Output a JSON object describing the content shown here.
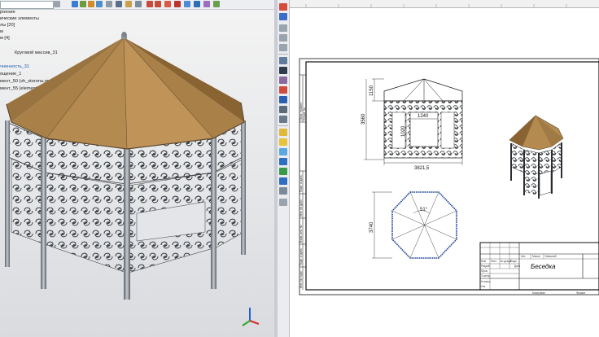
{
  "tree": {
    "items": [
      "роения",
      "ические элементы",
      "лы [20]",
      "м",
      "м [4]",
      "Круговой массив_31",
      "чненность_31",
      "ощение_1",
      "мент_50 (vh_storona.grs)",
      "мент_55 (element1verh.grs)"
    ]
  },
  "drawing": {
    "dimensions": {
      "roof_height": "1150",
      "total_height": "3560",
      "door_height": "1020",
      "door_width": "1240",
      "overall_width": "3821,5",
      "plan_width": "3740",
      "angle": "51°"
    },
    "title_block": {
      "part_name": "Беседка",
      "cells": [
        "Изм",
        "Лист",
        "№ докум.",
        "Подп.",
        "Дата",
        "Разраб.",
        "Пров.",
        "Т.контр.",
        "Н.контр.",
        "Утв.",
        "Лит.",
        "Масса",
        "Масштаб",
        "Копировал",
        "Формат"
      ]
    },
    "side_stamp": [
      "Перв. примен.",
      "Справ. №",
      "Подп. и дата",
      "Инв. № дубл.",
      "Взам. инв. №",
      "Подп. и дата",
      "Инв. № подл."
    ]
  },
  "colors": {
    "roof": "#b58a50",
    "roof_shade": "#8a6332",
    "metal": "#7f858c",
    "metal_dark": "#2b2f34",
    "accent_blue": "#1b3f9b"
  }
}
